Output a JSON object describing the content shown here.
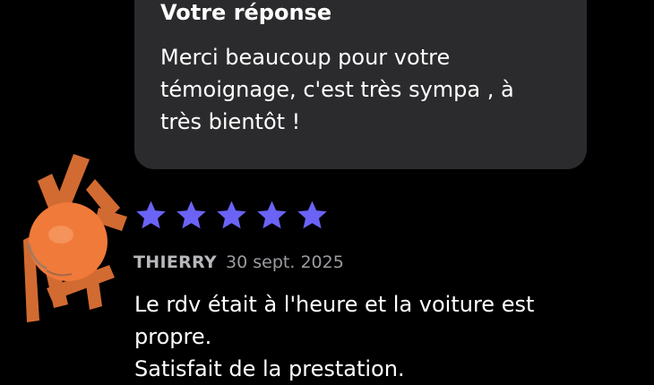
{
  "reply": {
    "title": "Votre réponse",
    "lines": [
      "Merci beaucoup pour votre",
      "témoignage, c'est très sympa , à",
      "très bientôt !"
    ]
  },
  "review": {
    "rating": 5,
    "rating_max": 5,
    "author": "THIERRY",
    "date": "30 sept. 2025",
    "lines": [
      "Le rdv était à l'heure et la voiture est",
      "propre.",
      "Satisfait de la prestation."
    ]
  },
  "colors": {
    "background": "#000000",
    "card": "#2b2b2d",
    "star": "#6b63f6",
    "avatar_redaction": "#f07a3a"
  },
  "icons": {
    "star": "star-icon",
    "avatar": "redacted-avatar"
  }
}
